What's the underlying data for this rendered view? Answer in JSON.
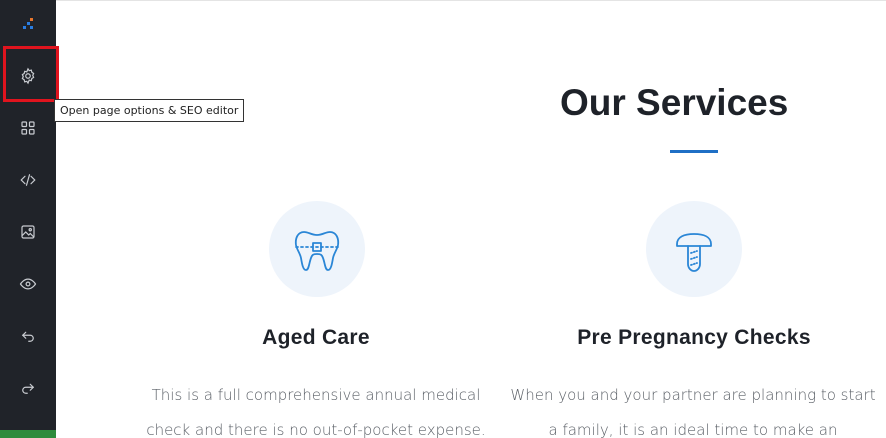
{
  "sidebar": {
    "tools": [
      {
        "name": "page-options",
        "icon": "gear-icon"
      },
      {
        "name": "blocks",
        "icon": "grid-icon"
      },
      {
        "name": "code",
        "icon": "code-icon"
      },
      {
        "name": "media",
        "icon": "image-icon"
      },
      {
        "name": "preview",
        "icon": "eye-icon"
      },
      {
        "name": "undo",
        "icon": "undo-icon"
      },
      {
        "name": "redo",
        "icon": "redo-icon"
      }
    ]
  },
  "tooltip": {
    "text": "Open page options & SEO editor"
  },
  "page": {
    "heading": "Our Services",
    "services": [
      {
        "title": "Aged Care",
        "text_line1": "This is a full comprehensive annual medical",
        "text_line2": "check and there is no out-of-pocket expense.",
        "icon": "tooth-braces-icon"
      },
      {
        "title": "Pre Pregnancy Checks",
        "text_line1": "When you and your partner are planning to start",
        "text_line2": "a family, it is an ideal time to make an",
        "icon": "dental-implant-icon"
      }
    ]
  },
  "colors": {
    "sidebar_bg": "#202329",
    "accent_blue": "#1f6fc5",
    "highlight_red": "#e0141e",
    "icon_circle_bg": "#eef4fb"
  }
}
